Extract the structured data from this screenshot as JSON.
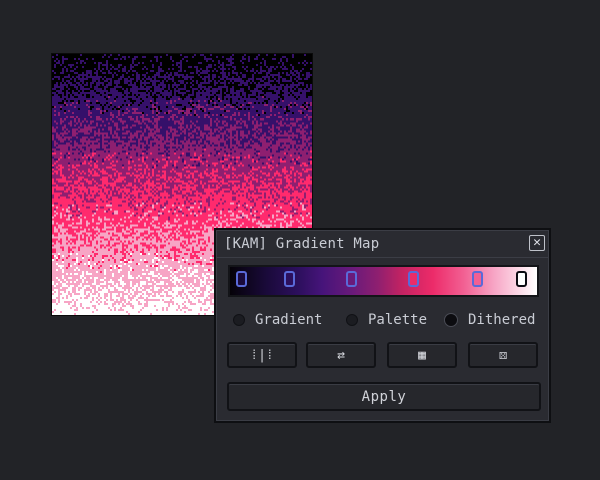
{
  "panel": {
    "title": "[KAM] Gradient Map",
    "close_symbol": "✕"
  },
  "gradient": {
    "stop_colors": [
      "#1a0a3a",
      "#2c0f5c",
      "#6a1a7a",
      "#ec2b69",
      "#f25f92",
      "#ffffff"
    ],
    "selected_stop_index": 5
  },
  "modes": [
    {
      "label": "Gradient",
      "selected": false
    },
    {
      "label": "Palette",
      "selected": false
    },
    {
      "label": "Dithered",
      "selected": true
    }
  ],
  "tools": [
    {
      "name": "distribute-icon",
      "glyph": "⁞|⁞"
    },
    {
      "name": "reverse-icon",
      "glyph": "⇄"
    },
    {
      "name": "add-stop-icon",
      "glyph": "▦"
    },
    {
      "name": "dice-icon",
      "glyph": "⚄"
    }
  ],
  "apply_label": "Apply",
  "canvas": {
    "gradient_colors": [
      "#000000",
      "#35106a",
      "#8e1f70",
      "#ff2a6d",
      "#f7a5c5",
      "#ffffff"
    ]
  }
}
